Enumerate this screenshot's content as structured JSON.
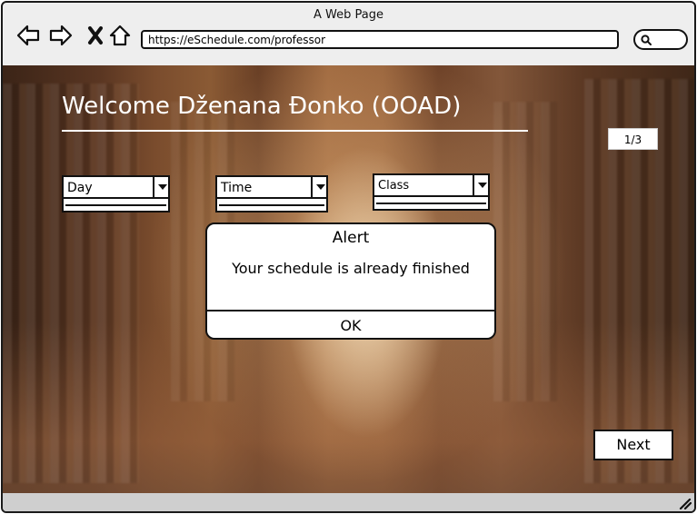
{
  "window": {
    "title": "A Web Page"
  },
  "toolbar": {
    "icons": [
      "back-arrow-icon",
      "forward-arrow-icon",
      "stop-icon",
      "home-icon",
      "search-icon"
    ],
    "address": "https://eSchedule.com/professor"
  },
  "page": {
    "title": "Welcome Dženana Đonko (OOAD)",
    "counter": "1/3",
    "dropdowns": {
      "day": {
        "value": "Day"
      },
      "time": {
        "value": "Time"
      },
      "class": {
        "value": "Class"
      }
    },
    "next_label": "Next"
  },
  "alert": {
    "title": "Alert",
    "message": "Your schedule is already finished",
    "ok_label": "OK"
  }
}
